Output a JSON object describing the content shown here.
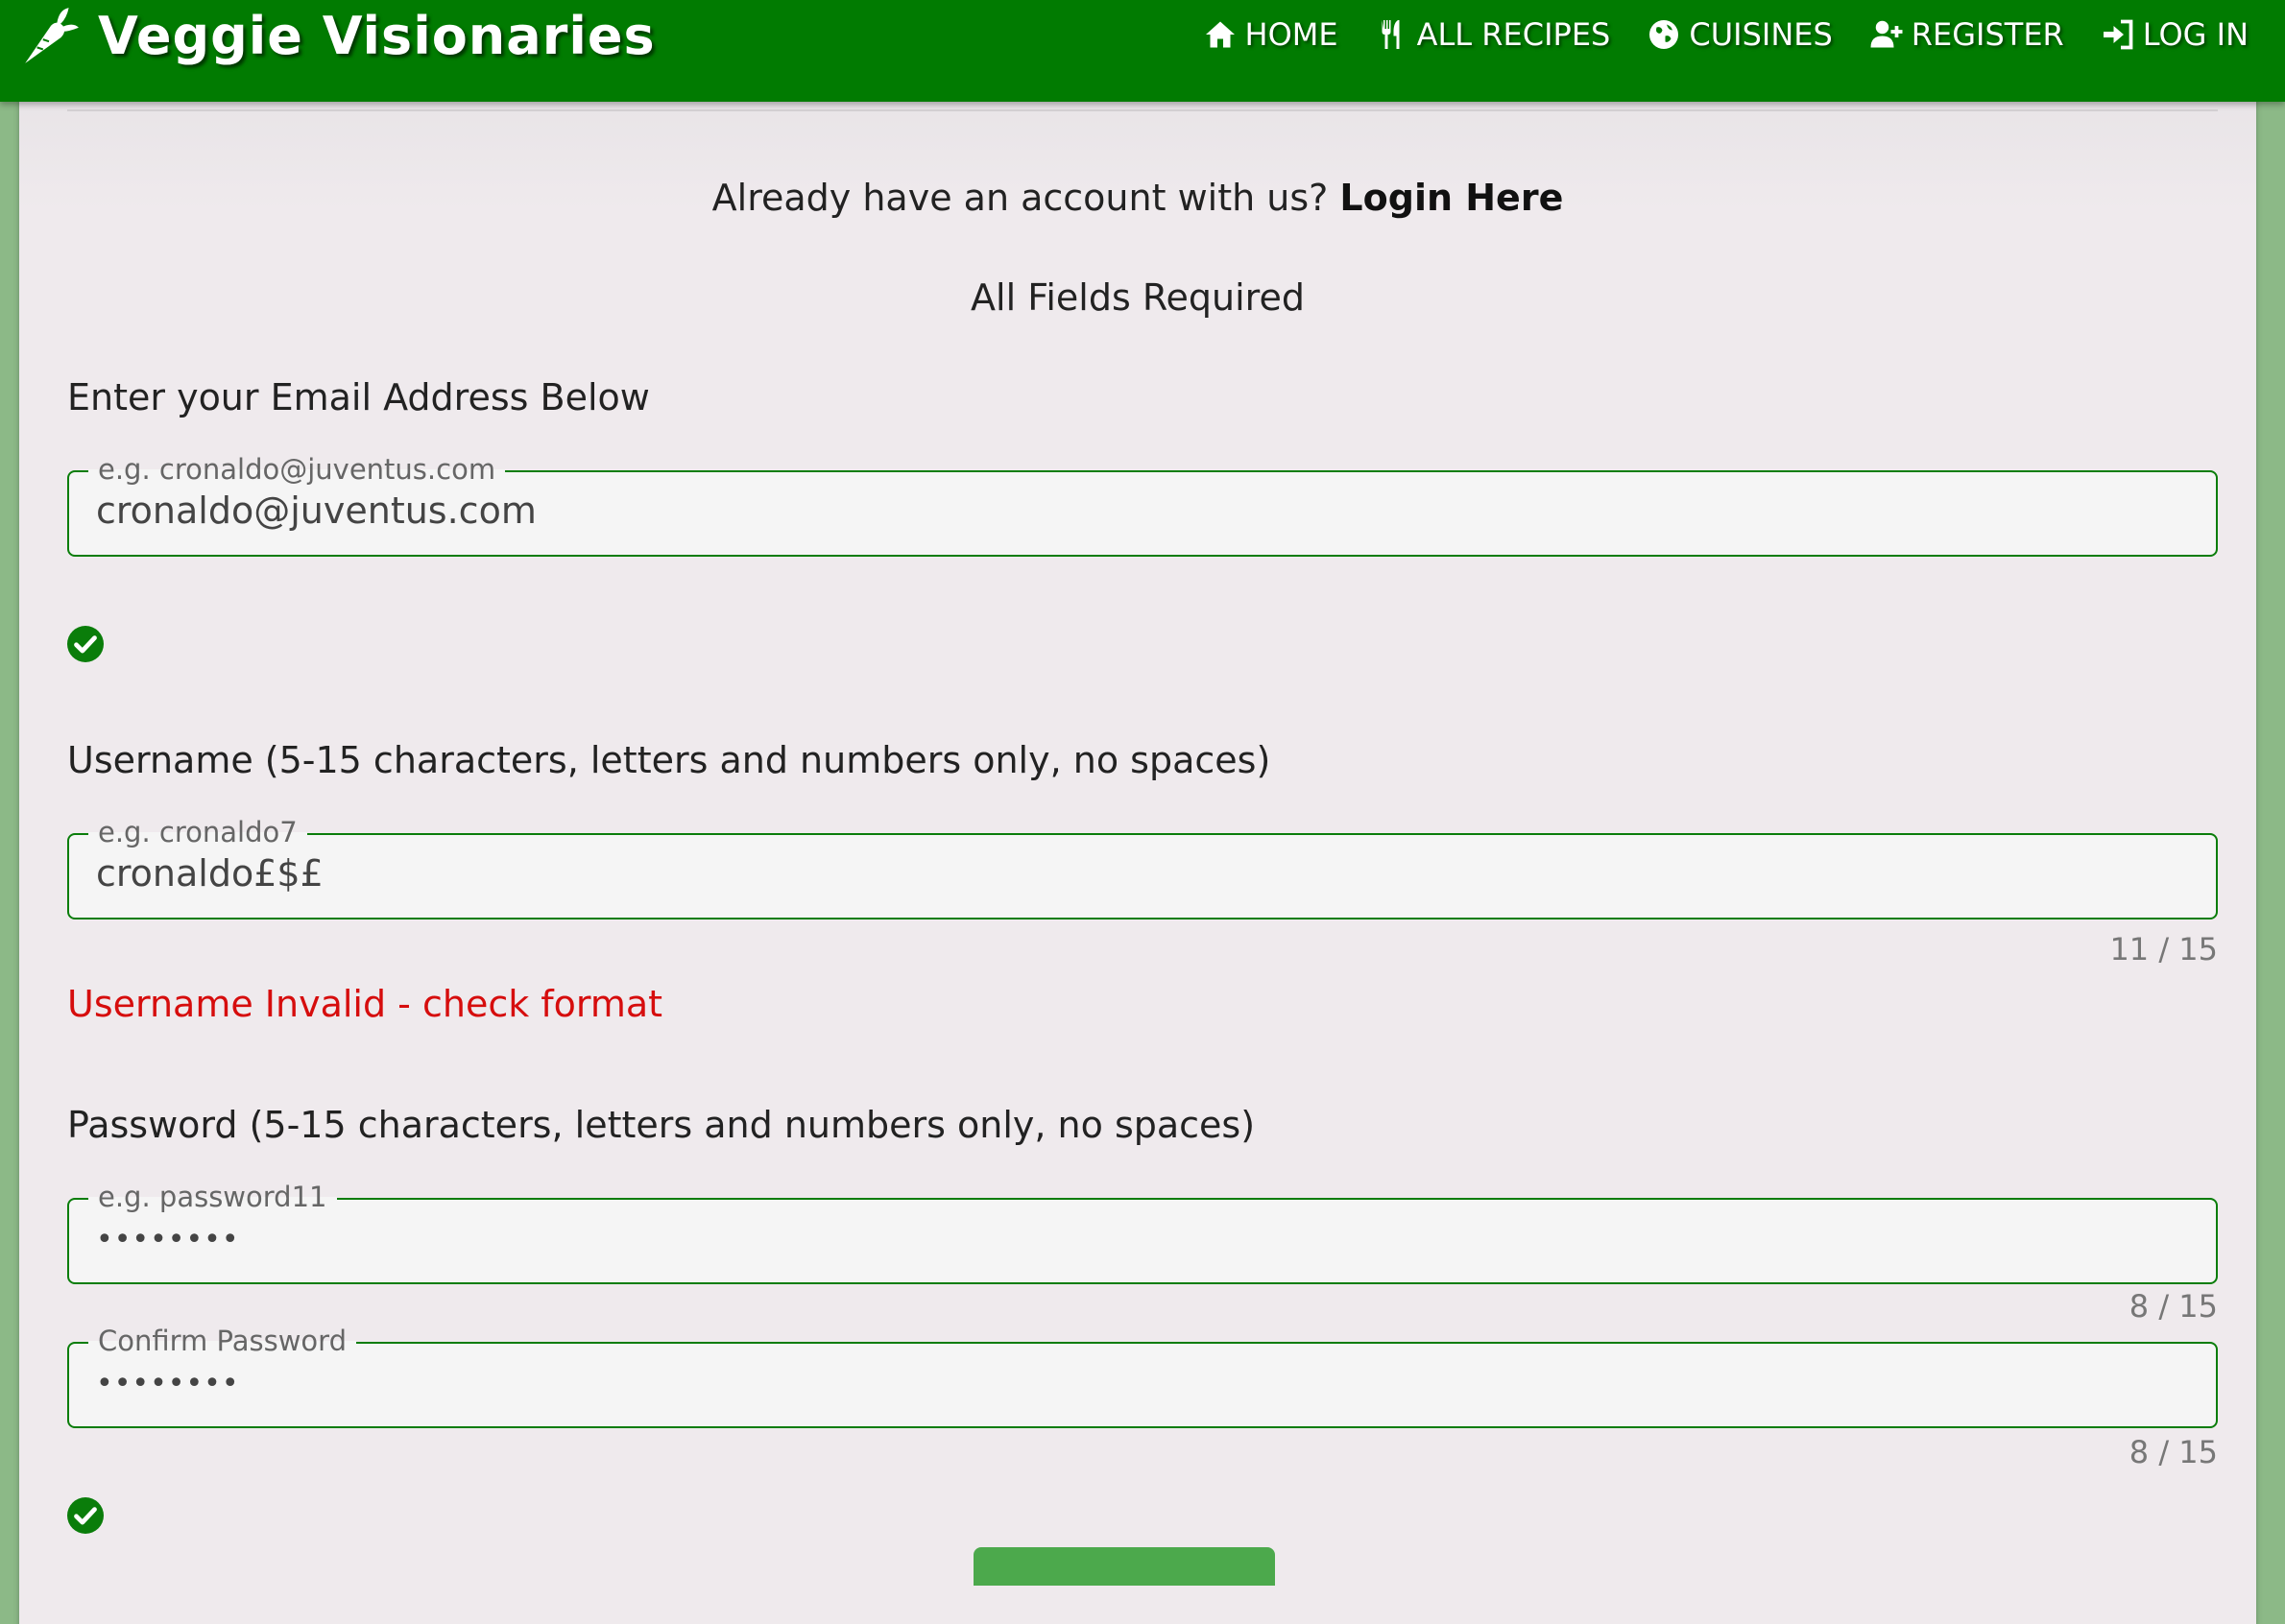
{
  "brand": {
    "name": "Veggie Visionaries",
    "icon": "carrot-icon"
  },
  "nav": [
    {
      "label": "HOME",
      "icon": "home-icon"
    },
    {
      "label": "ALL RECIPES",
      "icon": "utensils-icon"
    },
    {
      "label": "CUISINES",
      "icon": "globe-icon"
    },
    {
      "label": "REGISTER",
      "icon": "user-plus-icon"
    },
    {
      "label": "LOG IN",
      "icon": "sign-in-icon"
    }
  ],
  "intro": {
    "prompt": "Already have an account with us?",
    "login_link": "Login Here",
    "required_note": "All Fields Required"
  },
  "email": {
    "label": "Enter your Email Address Below",
    "placeholder": "e.g. cronaldo@juventus.com",
    "value": "cronaldo@juventus.com",
    "status": "valid"
  },
  "username": {
    "label": "Username (5-15 characters, letters and numbers only, no spaces)",
    "placeholder": "e.g. cronaldo7",
    "value": "cronaldo£$£",
    "counter": "11 / 15",
    "error": "Username Invalid - check format"
  },
  "password": {
    "label": "Password (5-15 characters, letters and numbers only, no spaces)",
    "placeholder": "e.g. password11",
    "value_masked": "••••••••",
    "counter": "8 / 15"
  },
  "confirm_password": {
    "placeholder": "Confirm Password",
    "value_masked": "••••••••",
    "counter": "8 / 15",
    "status": "valid"
  },
  "colors": {
    "navbar": "#017b01",
    "page_bg": "#8cb987",
    "card_bg": "#efeaed",
    "field_border": "#0a7d0a",
    "error": "#d60d0d",
    "check": "#0a7d0a",
    "button": "#4ca94c"
  }
}
